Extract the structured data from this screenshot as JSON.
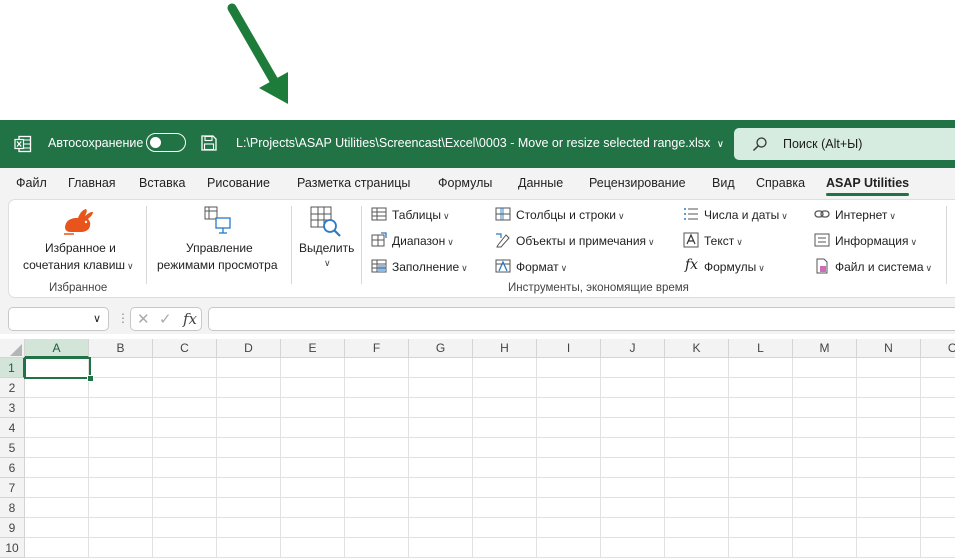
{
  "colors": {
    "excel_green": "#217346",
    "arrow_green": "#1e7c3a",
    "asap_orange": "#e8541c"
  },
  "titlebar": {
    "autosave_label": "Автосохранение",
    "file_path": "L:\\Projects\\ASAP Utilities\\Screencast\\Excel\\0003 - Move or resize selected range.xlsx",
    "search_placeholder": "Поиск (Alt+Ы)"
  },
  "tabs": [
    "Файл",
    "Главная",
    "Вставка",
    "Рисование",
    "Разметка страницы",
    "Формулы",
    "Данные",
    "Рецензирование",
    "Вид",
    "Справка",
    "ASAP Utilities"
  ],
  "active_tab": "ASAP Utilities",
  "ribbon": {
    "favorites": {
      "label_line1": "Избранное и",
      "label_line2": "сочетания клавиш",
      "group": "Избранное"
    },
    "view_modes": {
      "label_line1": "Управление",
      "label_line2": "режимами просмотра"
    },
    "select": {
      "label": "Выделить"
    },
    "col1": [
      "Таблицы",
      "Диапазон",
      "Заполнение"
    ],
    "col2": [
      "Столбцы и строки",
      "Объекты и примечания",
      "Формат"
    ],
    "col3": [
      "Числа и даты",
      "Текст",
      "Формулы"
    ],
    "col4": [
      "Интернет",
      "Информация",
      "Файл и система"
    ],
    "tools_group": "Инструменты, экономящие время"
  },
  "formula_bar": {
    "name_box": "",
    "fx": "fx",
    "value": ""
  },
  "grid": {
    "columns": [
      "A",
      "B",
      "C",
      "D",
      "E",
      "F",
      "G",
      "H",
      "I",
      "J",
      "K",
      "L",
      "M",
      "N",
      "O"
    ],
    "rows": [
      "1",
      "2",
      "3",
      "4",
      "5",
      "6",
      "7",
      "8",
      "9",
      "10"
    ],
    "active_cell": "A1"
  }
}
